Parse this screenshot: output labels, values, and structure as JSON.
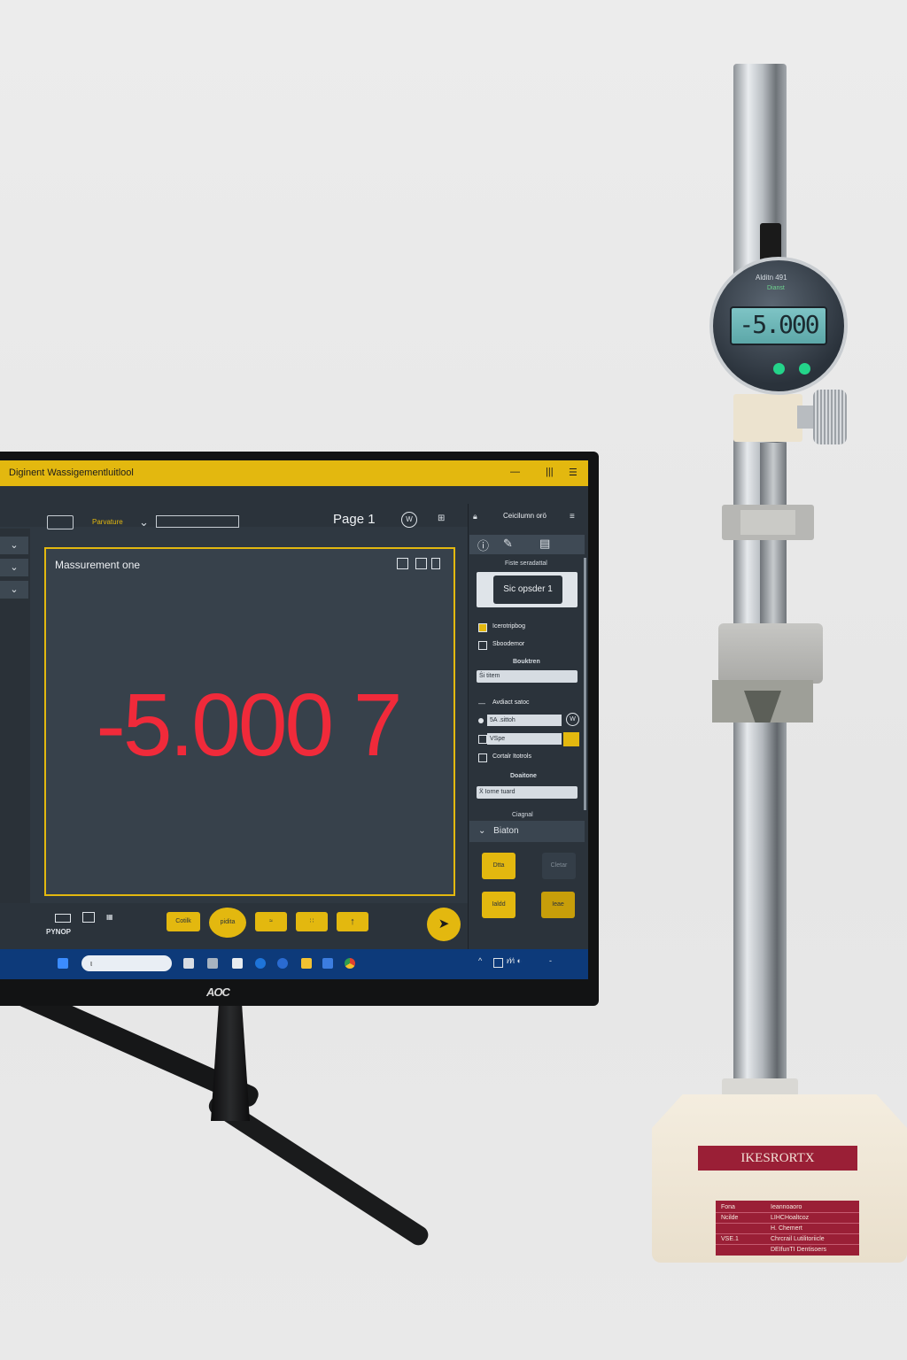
{
  "window": {
    "title": "Diginent Wassigementluitlool",
    "controls": [
      "—",
      "|||",
      "☰"
    ]
  },
  "toolbar": {
    "field_label": "Parvature",
    "page_label": "Page 1",
    "icon_left": "⊞"
  },
  "left_rail": {
    "buttons": [
      "⌄",
      "⌄",
      "⌄"
    ]
  },
  "main_panel": {
    "title": "Massurement one",
    "value": "-5.000 7"
  },
  "bottom_bar": {
    "left_text": "PYNOP",
    "buttons": [
      "Cotilk",
      "pidita",
      "≈",
      "∷",
      "↑"
    ],
    "action_icon": "➤"
  },
  "right_panel": {
    "header": "Ceicilumn orö",
    "section1": "Fiste seradattal",
    "main_button": "Sic opsder 1",
    "checkbox1": "Icerotripbog",
    "checkbox2": "Sboodemor",
    "section2": "Bouktren",
    "select1": "Ŝi titem",
    "section3": "Avdiact satoc",
    "field1": "5A .sittoh",
    "field2": "VSpe",
    "checkbox3": "Cortalr Itotrols",
    "section4": "Doaitone",
    "select2": "Ẍ Iorne tuard",
    "section5": "Ciagnal",
    "collapse_label": "Biaton",
    "grid_buttons": [
      "Dtta",
      "Cletar",
      "Ialdd",
      "Ieae"
    ]
  },
  "taskbar": {
    "search_placeholder": "ι",
    "tray_text": "ι⁄ι⁄ι ◐"
  },
  "monitor_brand": "AOC",
  "gauge": {
    "brand": "Alditn 491",
    "sub": "Dianst",
    "display": "-5.000"
  },
  "base": {
    "logo": "IKESRORTX",
    "plate": [
      {
        "k": "Fona",
        "v": "Ieannoaoro"
      },
      {
        "k": "Ncilde",
        "v": "LIHCHoaltcoz"
      },
      {
        "k": "",
        "v": "H. Chemert"
      },
      {
        "k": "VSE.1",
        "v": "Chrcrail Lutilitoriicle"
      },
      {
        "k": "",
        "v": "DEIfunTI Dentisoers"
      }
    ]
  },
  "colors": {
    "accent": "#e3b80f",
    "value_red": "#f02a3a",
    "screen_bg": "#2f3841",
    "taskbar": "#0d3a7a",
    "lcd": "#7ec4c5",
    "base_label": "#9a1f36"
  },
  "icons": [
    "windows-icon",
    "search-icon",
    "folder-icon",
    "chrome-icon",
    "settings-icon",
    "pen-icon",
    "info-icon",
    "list-icon"
  ]
}
